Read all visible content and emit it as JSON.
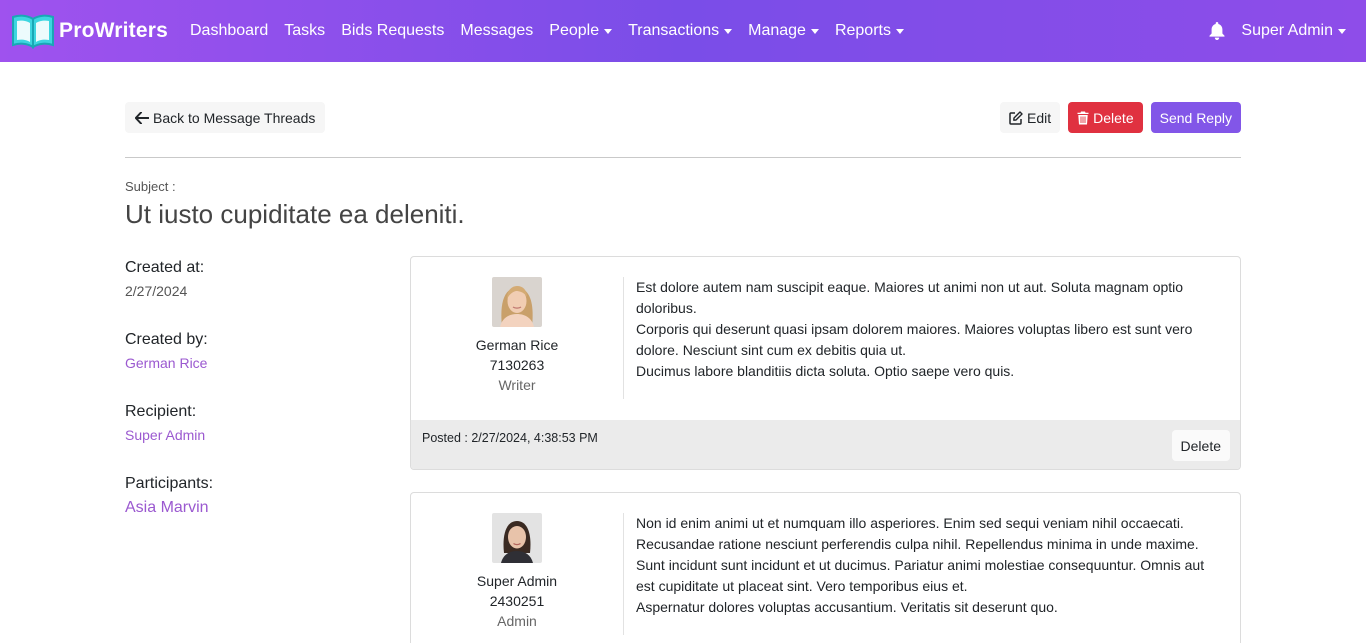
{
  "brand": {
    "name": "ProWriters",
    "logo_icon": "open-book-icon"
  },
  "nav": {
    "links": [
      {
        "label": "Dashboard",
        "dropdown": false
      },
      {
        "label": "Tasks",
        "dropdown": false
      },
      {
        "label": "Bids Requests",
        "dropdown": false
      },
      {
        "label": "Messages",
        "dropdown": false
      },
      {
        "label": "People",
        "dropdown": true
      },
      {
        "label": "Transactions",
        "dropdown": true
      },
      {
        "label": "Manage",
        "dropdown": true
      },
      {
        "label": "Reports",
        "dropdown": true
      }
    ],
    "notification_icon": "bell-icon",
    "user": "Super Admin"
  },
  "toolbar": {
    "back_label": "Back to Message Threads",
    "edit_label": "Edit",
    "delete_label": "Delete",
    "reply_label": "Send Reply"
  },
  "thread": {
    "subject_label": "Subject :",
    "subject": "Ut iusto cupiditate ea deleniti."
  },
  "meta": {
    "created_at_label": "Created at:",
    "created_at": "2/27/2024",
    "created_by_label": "Created by:",
    "created_by": "German Rice",
    "recipient_label": "Recipient:",
    "recipient": "Super Admin",
    "participants_label": "Participants:",
    "participants": "Asia Marvin"
  },
  "messages": [
    {
      "author": "German Rice",
      "id": "7130263",
      "role": "Writer",
      "lines": [
        "Est dolore autem nam suscipit eaque. Maiores ut animi non ut aut. Soluta magnam optio doloribus.",
        "Corporis qui deserunt quasi ipsam dolorem maiores. Maiores voluptas libero est sunt vero dolore. Nesciunt sint cum ex debitis quia ut.",
        "Ducimus labore blanditiis dicta soluta. Optio saepe vero quis."
      ],
      "posted": "Posted : 2/27/2024, 4:38:53 PM",
      "delete_label": "Delete"
    },
    {
      "author": "Super Admin",
      "id": "2430251",
      "role": "Admin",
      "lines": [
        "Non id enim animi ut et numquam illo asperiores. Enim sed sequi veniam nihil occaecati.",
        "Recusandae ratione nesciunt perferendis culpa nihil. Repellendus minima in unde maxime.",
        "Sunt incidunt sunt incidunt et ut ducimus. Pariatur animi molestiae consequuntur. Omnis aut est cupiditate ut placeat sint. Vero temporibus eius et.",
        "Aspernatur dolores voluptas accusantium. Veritatis sit deserunt quo."
      ]
    }
  ],
  "colors": {
    "navbar_start": "#9f52ee",
    "navbar_end": "#7a4de8",
    "danger": "#e03140",
    "primary": "#8256e8",
    "link": "#9b59d0"
  }
}
